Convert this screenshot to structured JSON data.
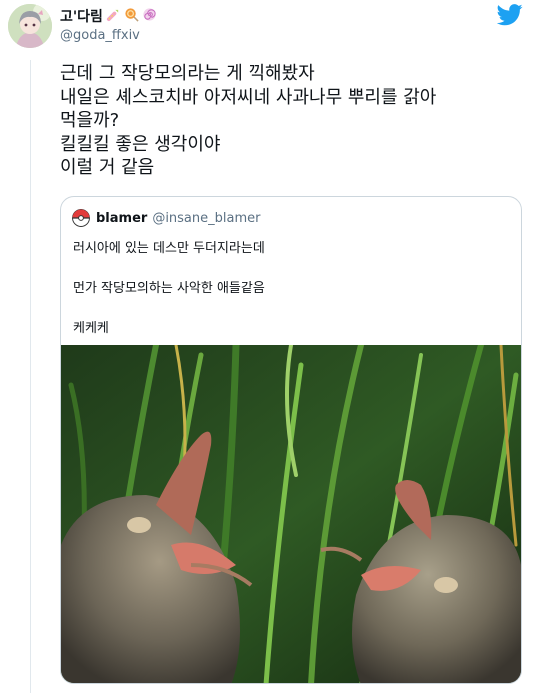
{
  "author": {
    "display_name": "고'다림",
    "handle": "@goda_ffxiv",
    "name_emojis": [
      "candy-icon",
      "lollipop-icon",
      "swirl-lollipop-icon"
    ],
    "avatar": "anime-character-avatar"
  },
  "brand_icon": "twitter-bird-icon",
  "tweet_lines": [
    "근데 그 작당모의라는 게 끽해봤자",
    "내일은 셰스코치바 아저씨네 사과나무 뿌리를 갉아",
    "먹을까?",
    "킬킬킬 좋은 생각이야",
    "이럴 거 같음"
  ],
  "quoted": {
    "display_name": "blamer",
    "handle": "@insane_blamer",
    "avatar": "pokeball-avatar",
    "lines": [
      "러시아에 있는 데스만 두더지라는데",
      "먼가 작당모의하는 사악한 애들같음",
      "케케케"
    ],
    "media": "two-desmans-photo"
  },
  "colors": {
    "text": "#0f1419",
    "secondary": "#5b7083",
    "twitter_blue": "#1da1f2",
    "border": "#ccd6dd"
  }
}
